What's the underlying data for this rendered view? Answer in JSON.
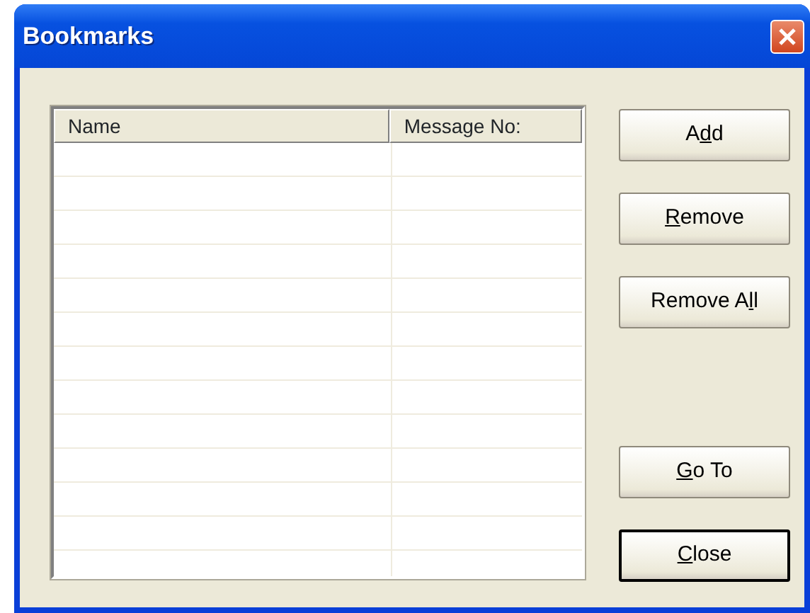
{
  "window": {
    "title": "Bookmarks"
  },
  "list": {
    "columns": [
      "Name",
      "Message No:"
    ]
  },
  "top_buttons": [
    {
      "label_start": "A",
      "access_key": "d",
      "label_end": "d",
      "default": false
    },
    {
      "access_key": "R",
      "label_end": "emove",
      "default": false
    },
    {
      "label_start": "Remove A",
      "access_key": "l",
      "label_end": "l",
      "default": false
    }
  ],
  "bottom_buttons": [
    {
      "access_key": "G",
      "label_end": "o To",
      "default": false
    },
    {
      "access_key": "C",
      "label_end": "lose",
      "default": true
    }
  ]
}
